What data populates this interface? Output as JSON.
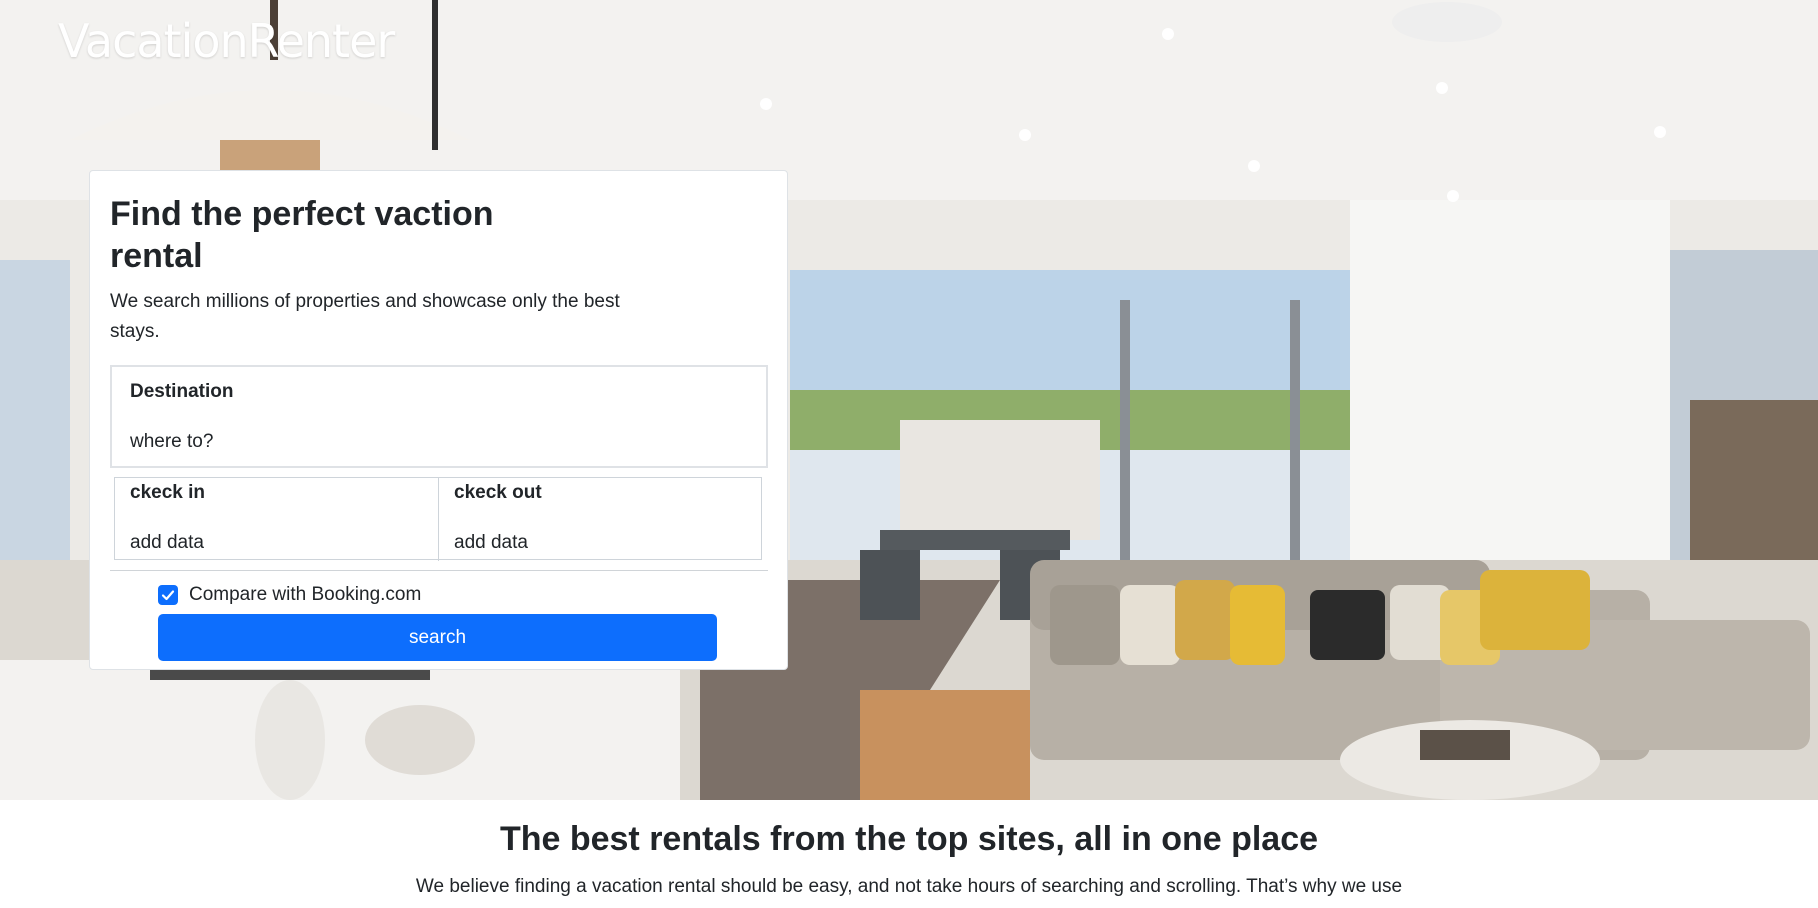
{
  "header": {
    "brand": "VacationRenter"
  },
  "search_card": {
    "title": "Find the perfect vaction rental",
    "subtitle": "We search millions of properties and showcase only the best stays.",
    "destination": {
      "label": "Destination",
      "placeholder": "where to?"
    },
    "check_in": {
      "label": "ckeck in",
      "placeholder": "add data"
    },
    "check_out": {
      "label": "ckeck out",
      "placeholder": "add data"
    },
    "compare": {
      "label": "Compare with Booking.com",
      "checked": true
    },
    "search_button": "search"
  },
  "section": {
    "title": "The best rentals from the top sites, all in one place",
    "text": "We believe finding a vacation rental should be easy, and not take hours of searching and scrolling. That’s why we use"
  },
  "colors": {
    "primary": "#0d6efd",
    "text": "#212529",
    "border": "#dee2e6"
  }
}
